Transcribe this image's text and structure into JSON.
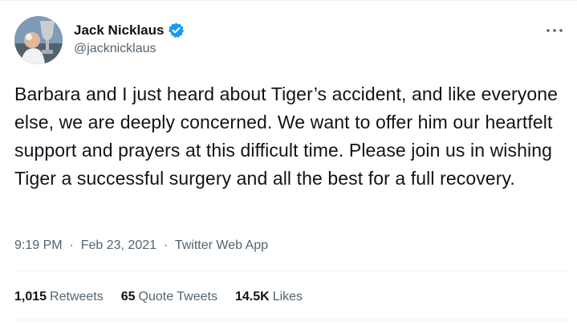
{
  "tweet": {
    "author_name": "Jack Nicklaus",
    "author_handle": "@jacknicklaus",
    "verified_color": "#1d9bf0",
    "text": "Barbara and I just heard about Tiger’s accident, and like everyone else, we are deeply concerned. We want to offer him our heartfelt support and prayers at this difficult time. Please join us in wishing Tiger a successful surgery and all the best for a full recovery.",
    "time": "9:19 PM",
    "date": "Feb 23, 2021",
    "source": "Twitter Web App",
    "dot": "·",
    "more_icon": "more-horizontal-icon"
  },
  "stats": {
    "retweets_count": "1,015",
    "retweets_label": "Retweets",
    "quotes_count": "65",
    "quotes_label": "Quote Tweets",
    "likes_count": "14.5K",
    "likes_label": "Likes"
  }
}
